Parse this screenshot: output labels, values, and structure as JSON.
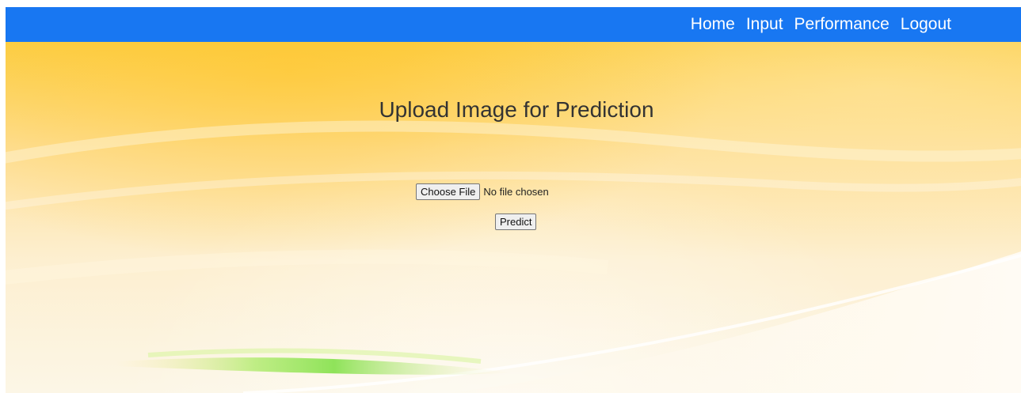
{
  "nav": {
    "home": "Home",
    "input": "Input",
    "performance": "Performance",
    "logout": "Logout"
  },
  "main": {
    "title": "Upload Image for Prediction",
    "file_button": "Choose File",
    "file_status": "No file chosen",
    "predict_button": "Predict"
  },
  "colors": {
    "nav_bar": "#1877f2",
    "nav_text": "#ffffff",
    "title_text": "#333333",
    "background_top": "#fccf47",
    "background_bottom": "#fcf6e6",
    "accent_green": "#8fe35a"
  }
}
